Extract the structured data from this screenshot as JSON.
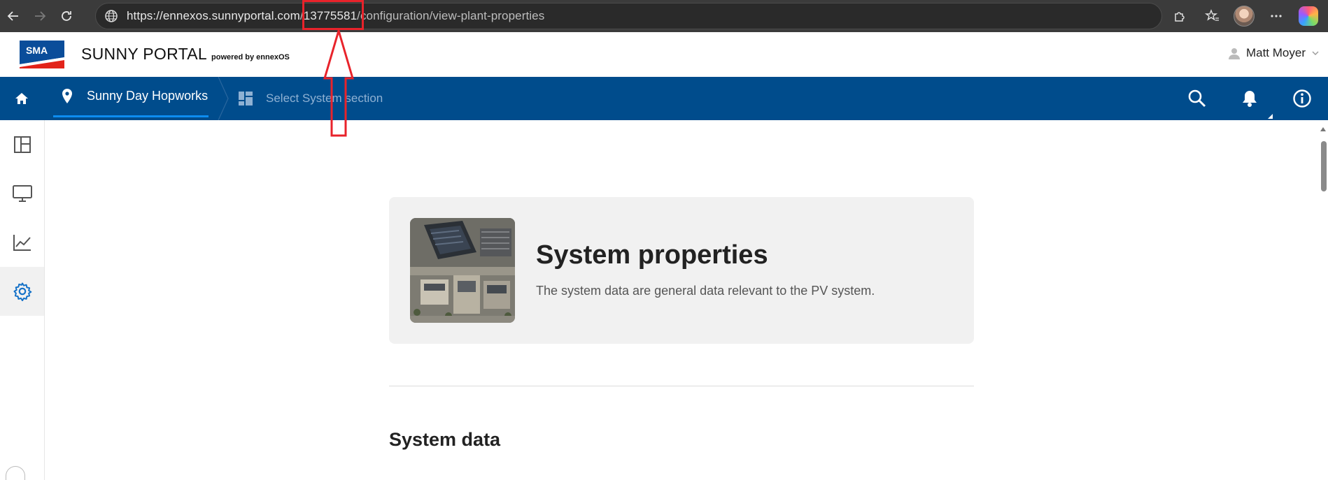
{
  "browser": {
    "url_host": "https://ennexos.sunnyportal.com",
    "url_slash": "/",
    "url_id": "13775581",
    "url_path": "/configuration/view-plant-properties"
  },
  "header": {
    "logo_text": "SMA",
    "brand": "SUNNY PORTAL",
    "brand_sub": "powered by ennexOS",
    "user_name": "Matt Moyer"
  },
  "nav": {
    "plant_name": "Sunny Day Hopworks",
    "section_placeholder": "Select System section"
  },
  "card": {
    "title": "System properties",
    "description": "The system data are general data relevant to the PV system."
  },
  "sections": {
    "system_data": "System data"
  },
  "colors": {
    "brand_blue": "#004c8c",
    "accent_blue": "#0d8cf0",
    "annotation_red": "#e8232b"
  }
}
